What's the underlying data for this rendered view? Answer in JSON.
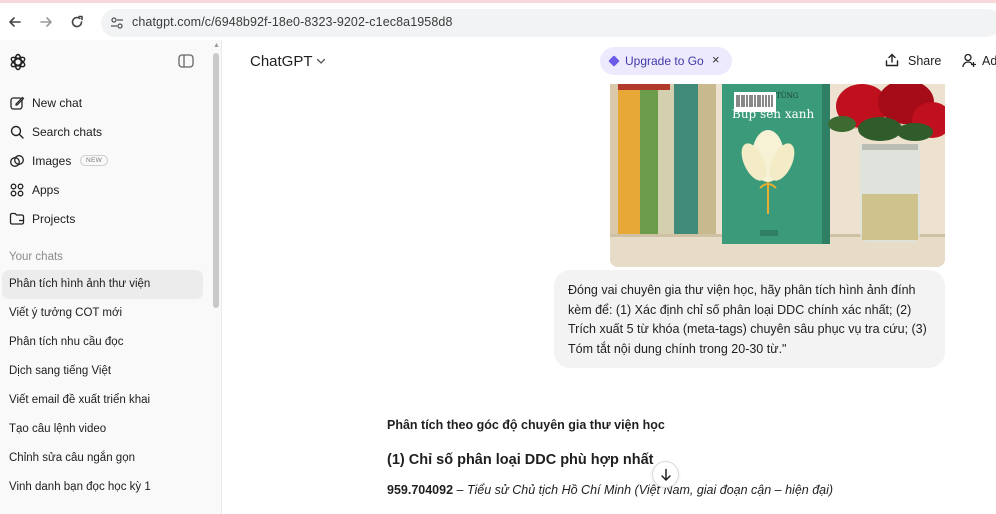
{
  "browser": {
    "url": "chatgpt.com/c/6948b92f-18e0-8323-9202-c1ec8a1958d8"
  },
  "sidebar": {
    "menu": [
      {
        "label": "New chat",
        "icon": "edit-icon"
      },
      {
        "label": "Search chats",
        "icon": "search-icon"
      },
      {
        "label": "Images",
        "icon": "images-icon",
        "badge": "NEW"
      },
      {
        "label": "Apps",
        "icon": "apps-icon"
      },
      {
        "label": "Projects",
        "icon": "folder-icon"
      }
    ],
    "section_label": "Your chats",
    "chats": [
      {
        "label": "Phân tích hình ảnh thư viện",
        "active": true
      },
      {
        "label": "Viết ý tưởng COT mới"
      },
      {
        "label": "Phân tích nhu cầu đọc"
      },
      {
        "label": "Dịch sang tiếng Việt"
      },
      {
        "label": "Viết email đề xuất triển khai"
      },
      {
        "label": "Tạo câu lệnh video"
      },
      {
        "label": "Chỉnh sửa câu ngắn gọn"
      },
      {
        "label": "Vinh danh bạn đọc học kỳ 1"
      }
    ]
  },
  "header": {
    "model": "ChatGPT",
    "upgrade_label": "Upgrade to Go",
    "upgrade_close": "×",
    "share_label": "Share",
    "add_label": "Ad"
  },
  "photo": {
    "book_title": "Búp sen xanh",
    "author_fragment": "TÙNG",
    "accent_colors": {
      "book": "#3a9a7a",
      "flower": "#c0101e",
      "shelf": "#e9dcc3"
    }
  },
  "conversation": {
    "user_message": "Đóng vai chuyên gia thư viện học, hãy phân tích hình ảnh đính kèm để: (1) Xác định chỉ số phân loại DDC chính xác nhất; (2) Trích xuất 5 từ khóa (meta-tags) chuyên sâu phục vụ tra cứu; (3) Tóm tắt nội dung chính trong 20-30 từ.\"",
    "answer_heading": "Phân tích theo góc độ chuyên gia thư viện học",
    "answer_section": "(1) Chỉ số phân loại DDC phù hợp nhất",
    "ddc_code": "959.704092",
    "ddc_desc": " – Tiểu sử Chủ tịch Hồ Chí Minh (Việt Nam, giai đoạn cận – hiện đại)"
  }
}
